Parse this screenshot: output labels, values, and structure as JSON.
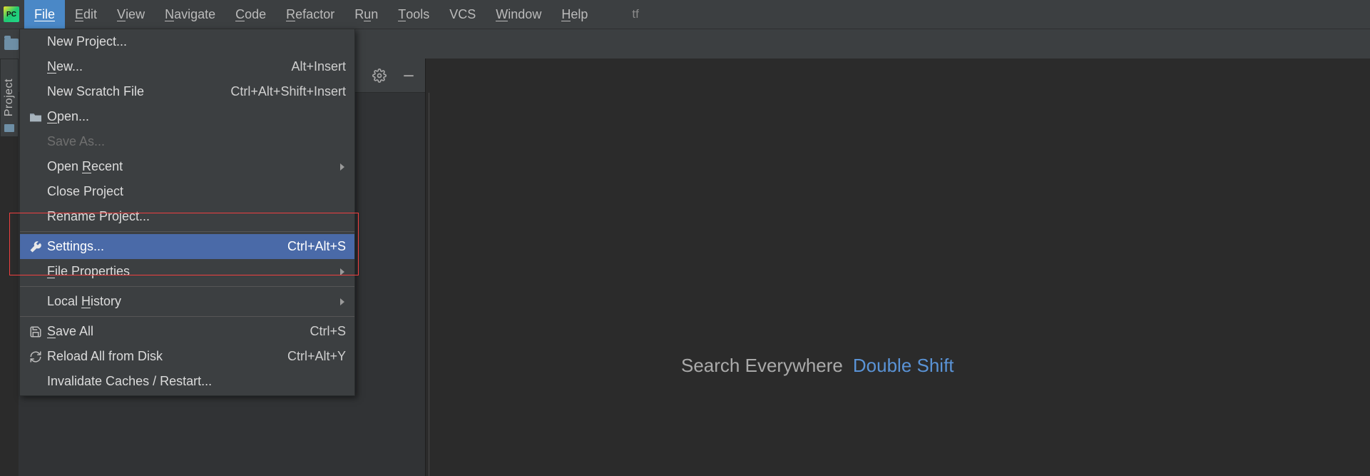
{
  "app": {
    "icon_label": "PC",
    "project_name": "tf"
  },
  "menubar": {
    "file": "File",
    "edit": "Edit",
    "view": "View",
    "navigate": "Navigate",
    "code": "Code",
    "refactor": "Refactor",
    "run": "Run",
    "tools": "Tools",
    "vcs": "VCS",
    "window": "Window",
    "help": "Help"
  },
  "left_rail": {
    "project": "Project"
  },
  "file_menu": {
    "new_project": "New Project...",
    "new": "New...",
    "new_shortcut": "Alt+Insert",
    "new_scratch": "New Scratch File",
    "new_scratch_shortcut": "Ctrl+Alt+Shift+Insert",
    "open": "Open...",
    "save_as": "Save As...",
    "open_recent": "Open Recent",
    "close_project": "Close Project",
    "rename_project": "Rename Project...",
    "settings": "Settings...",
    "settings_shortcut": "Ctrl+Alt+S",
    "file_properties": "File Properties",
    "local_history": "Local History",
    "save_all": "Save All",
    "save_all_shortcut": "Ctrl+S",
    "reload_disk": "Reload All from Disk",
    "reload_disk_shortcut": "Ctrl+Alt+Y",
    "invalidate": "Invalidate Caches / Restart..."
  },
  "editor": {
    "search_everywhere_label": "Search Everywhere",
    "search_everywhere_shortcut": "Double Shift"
  }
}
